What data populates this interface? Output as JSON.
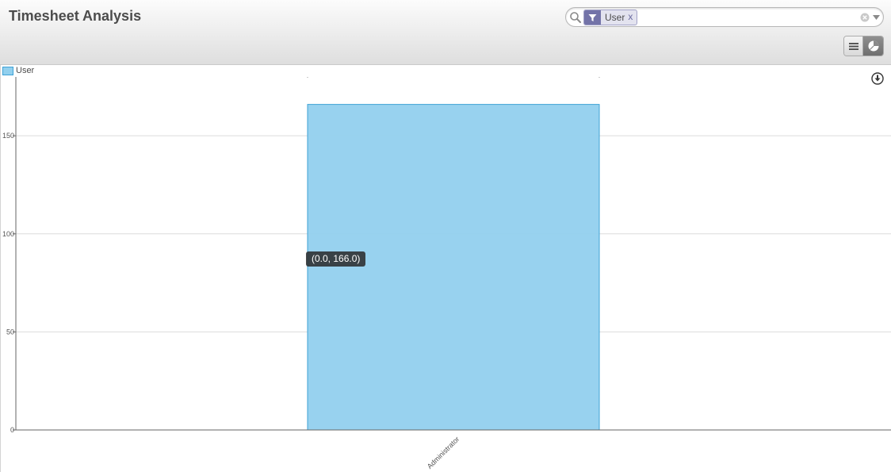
{
  "header": {
    "title": "Timesheet Analysis"
  },
  "search": {
    "facet_value": "User",
    "facet_remove": "x",
    "placeholder": ""
  },
  "view_switch": {
    "active": "graph"
  },
  "icons": {
    "search": "search-icon",
    "facet_filter": "filter-icon",
    "clear": "clear-search-icon",
    "dropdown": "chevron-down-icon",
    "list_view": "list-view-icon",
    "graph_view": "pie-chart-icon",
    "download": "download-icon"
  },
  "colors": {
    "bar_fill": "#92d0ee",
    "bar_stroke": "#3ea2d6",
    "facet_accent": "#7373a8"
  },
  "chart_data": {
    "type": "bar",
    "title": "",
    "xlabel": "",
    "ylabel": "",
    "categories": [
      "Administrator"
    ],
    "series": [
      {
        "name": "User",
        "values": [
          166.0
        ]
      }
    ],
    "ylim": [
      0,
      180
    ],
    "yticks": [
      0,
      50,
      100,
      150
    ],
    "ytick_labels": [
      "0",
      "50",
      "100",
      "150"
    ],
    "grid": true,
    "legend": "top-left",
    "tooltip": "(0.0, 166.0)"
  }
}
